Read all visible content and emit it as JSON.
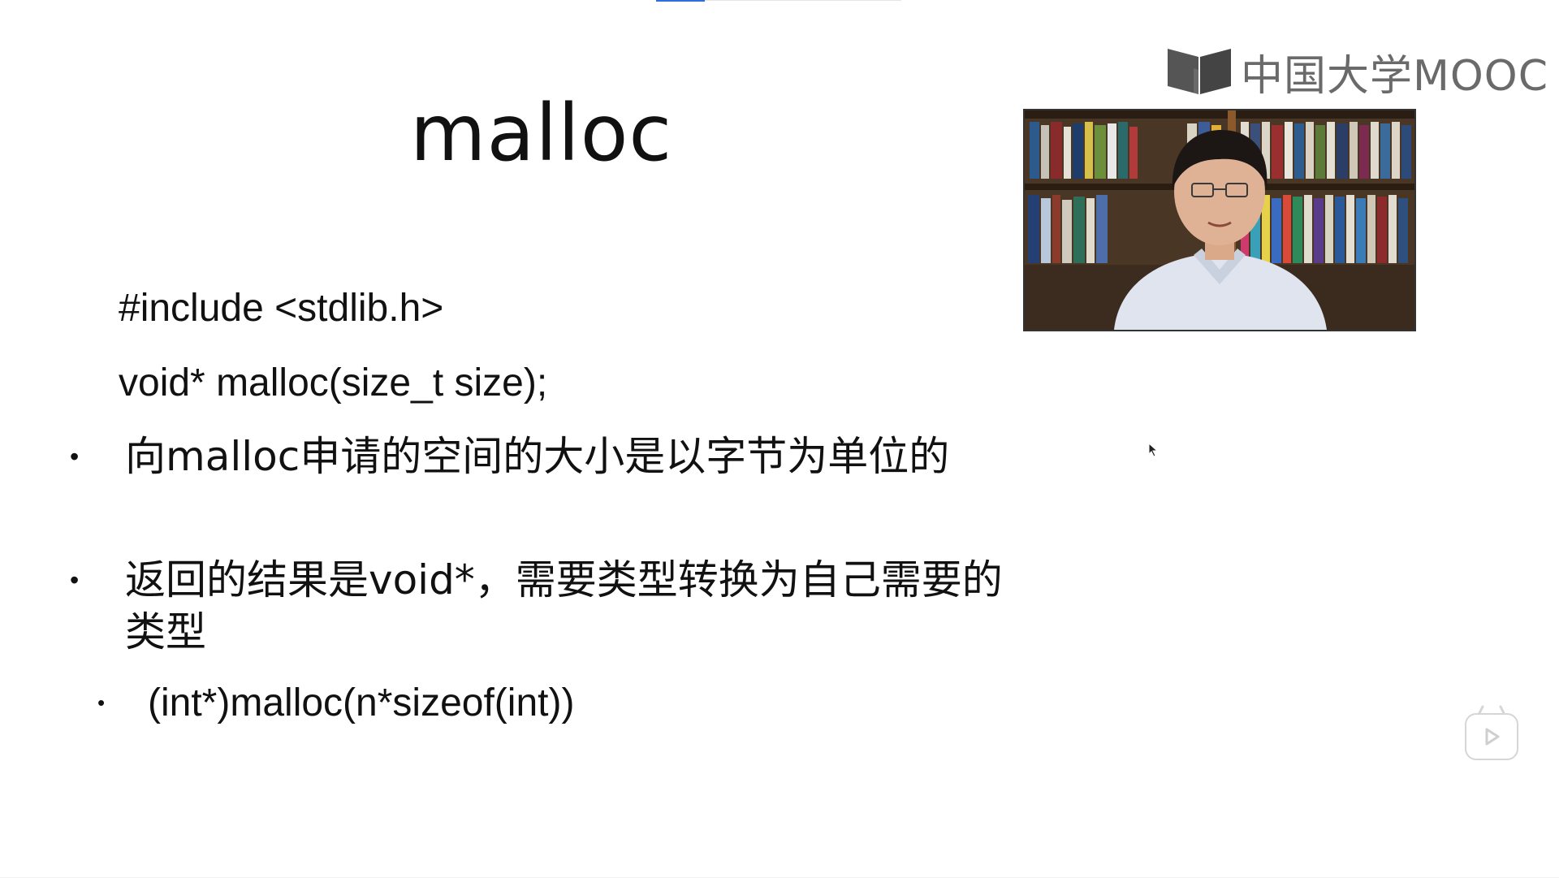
{
  "slide": {
    "title": "malloc",
    "code_lines": [
      "#include <stdlib.h>",
      "void* malloc(size_t size);"
    ],
    "bullets": [
      "向malloc申请的空间的大小是以字节为单位的",
      "返回的结果是void*，需要类型转换为自己需要的类型"
    ],
    "sub_bullets": [
      "(int*)malloc(n*sizeof(int))"
    ],
    "bullet_glyph": "•"
  },
  "brand": {
    "logo_text": "中国大学MOOC",
    "logo_icon": "mooc-book-icon",
    "logo_color": "#6a6a6a"
  },
  "webcam": {
    "icon": "lecturer-video"
  },
  "player": {
    "play_icon": "play-icon",
    "progress_color": "#2f6fdc"
  }
}
